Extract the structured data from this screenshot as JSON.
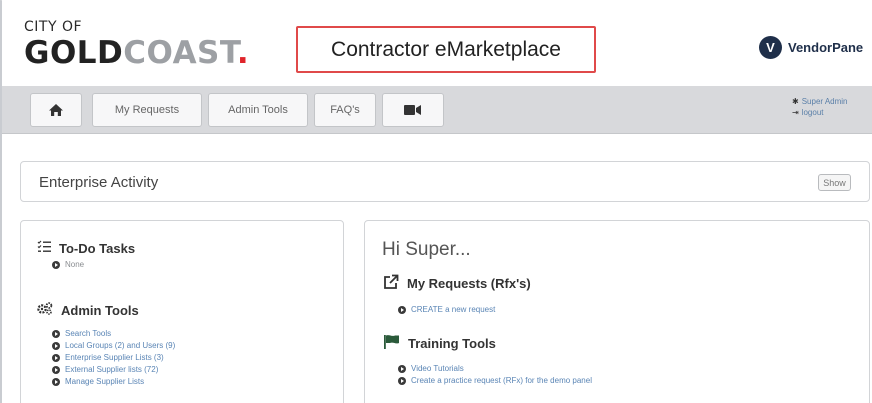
{
  "header": {
    "logo_city": "CITY OF",
    "logo_gold": "GOLD",
    "logo_coast": "COAST",
    "logo_dot": ".",
    "app_title": "Contractor eMarketplace",
    "vendor_logo_letter": "V",
    "vendor_name": "VendorPane"
  },
  "nav": {
    "tabs": [
      {
        "label": "",
        "icon": "home-icon"
      },
      {
        "label": "My Requests"
      },
      {
        "label": "Admin Tools"
      },
      {
        "label": "FAQ's"
      },
      {
        "label": "",
        "icon": "video-camera-icon"
      }
    ],
    "user_name": "Super Admin",
    "logout_label": "logout"
  },
  "activity": {
    "label": "Enterprise Activity",
    "show_label": "Show"
  },
  "left": {
    "todo_title": "To-Do Tasks",
    "todo_items": [
      "None"
    ],
    "admin_title": "Admin Tools",
    "admin_items": [
      "Search Tools",
      "Local Groups (2) and Users (9)",
      "Enterprise Supplier Lists (3)",
      "External Supplier lists (72)",
      "Manage Supplier Lists"
    ]
  },
  "right": {
    "greeting": "Hi Super...",
    "requests_title": "My Requests (Rfx's)",
    "requests_items": [
      "CREATE a new request"
    ],
    "training_title": "Training Tools",
    "training_items": [
      "Video Tutorials",
      "Create a practice request (RFx) for the demo panel"
    ]
  },
  "colors": {
    "accent_red": "#e0242a",
    "title_border": "#e04a4a",
    "link_blue": "#5a85b5",
    "training_flag": "#2a5a3a",
    "nav_bg": "#d8d9dc"
  }
}
